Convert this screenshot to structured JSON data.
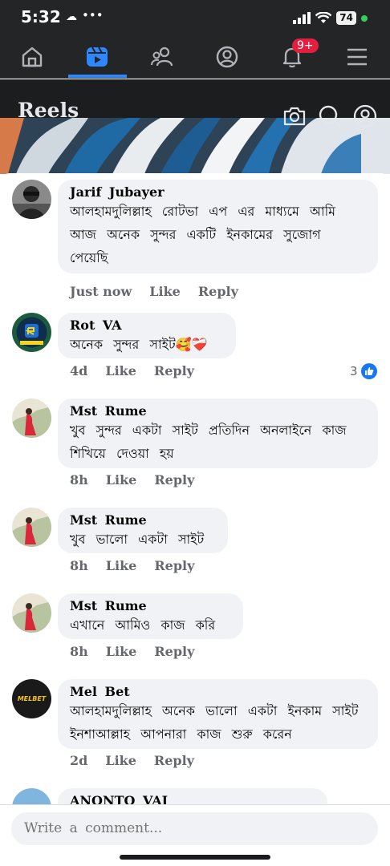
{
  "status": {
    "time": "5:32",
    "cloud": "☁",
    "dots": "•••",
    "battery": "74"
  },
  "nav": {
    "notification_badge": "9+"
  },
  "header": {
    "title": "Reels"
  },
  "comments": [
    {
      "author": "Jarif Jubayer",
      "text": "আলহামদুলিল্লাহ রোটভা এপ এর মাধ্যমে আমি আজ অনেক সুন্দর একটি ইনকামের সুজোগ পেয়েছি",
      "time": "Just now",
      "like": "Like",
      "reply": "Reply"
    },
    {
      "author": "Rot VA",
      "text": "অনেক সুন্দর সাইট🥰❤️‍🩹",
      "time": "4d",
      "like": "Like",
      "reply": "Reply",
      "reactions": "3"
    },
    {
      "author": "Mst Rume",
      "text": "খুব সুন্দর একটা সাইট প্রতিদিন অনলাইনে কাজ শিখিয়ে দেওয়া হয়",
      "time": "8h",
      "like": "Like",
      "reply": "Reply"
    },
    {
      "author": "Mst Rume",
      "text": "খুব ভালো একটা সাইট",
      "time": "8h",
      "like": "Like",
      "reply": "Reply"
    },
    {
      "author": "Mst Rume",
      "text": "এখানে আমিও কাজ করি",
      "time": "8h",
      "like": "Like",
      "reply": "Reply"
    },
    {
      "author": "Mel Bet",
      "text": "আলহামদুলিল্লাহ অনেক ভালো একটা ইনকাম সাইট ইনশাআল্লাহ আপনারা কাজ শুরু করেন",
      "time": "2d",
      "like": "Like",
      "reply": "Reply",
      "avatar_text": "MELBET"
    },
    {
      "author": "ANONTO VAI"
    }
  ],
  "composer": {
    "placeholder": "Write a comment..."
  },
  "colors": {
    "accent": "#2d88ff",
    "badge": "#e41e3f",
    "like_blue": "#1877f2"
  }
}
